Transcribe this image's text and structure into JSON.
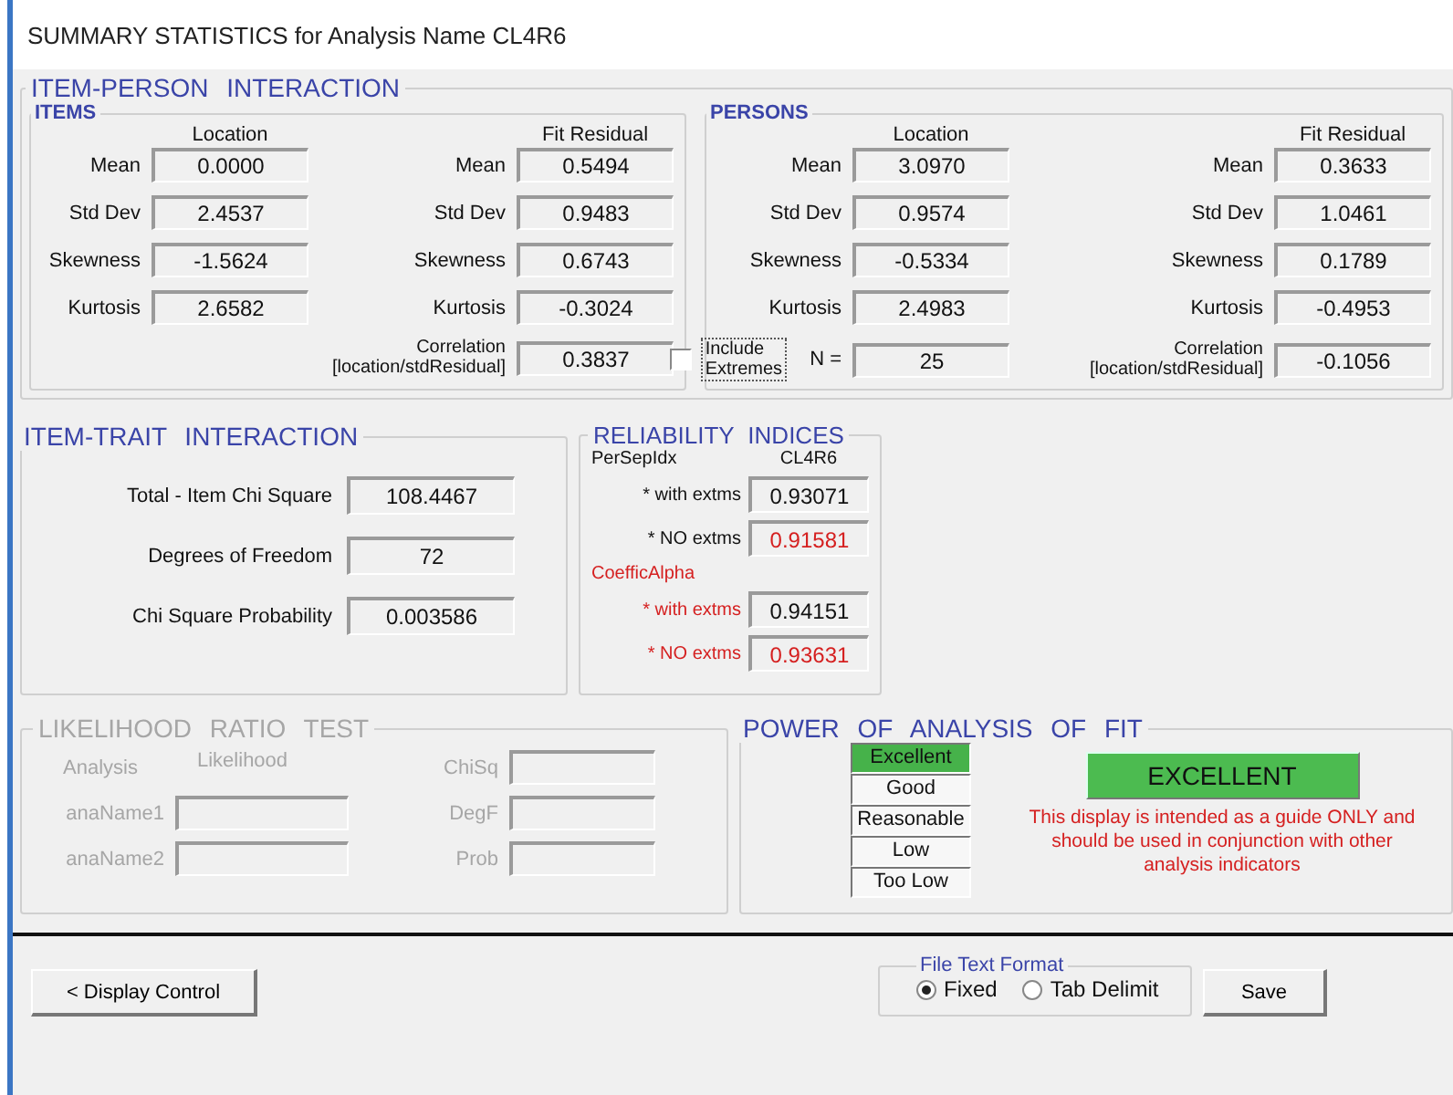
{
  "window": {
    "title": "SUMMARY STATISTICS for Analysis Name CL4R6"
  },
  "item_person": {
    "title": "ITEM-PERSON INTERACTION",
    "items": {
      "title": "ITEMS",
      "location_header": "Location",
      "fit_header": "Fit Residual",
      "location": [
        {
          "label": "Mean",
          "value": "0.0000"
        },
        {
          "label": "Std Dev",
          "value": "2.4537"
        },
        {
          "label": "Skewness",
          "value": "-1.5624"
        },
        {
          "label": "Kurtosis",
          "value": "2.6582"
        }
      ],
      "fit": [
        {
          "label": "Mean",
          "value": "0.5494"
        },
        {
          "label": "Std Dev",
          "value": "0.9483"
        },
        {
          "label": "Skewness",
          "value": "0.6743"
        },
        {
          "label": "Kurtosis",
          "value": "-0.3024"
        },
        {
          "label": "Correlation\n[location/stdResidual]",
          "value": "0.3837"
        }
      ]
    },
    "persons": {
      "title": "PERSONS",
      "location_header": "Location",
      "fit_header": "Fit Residual",
      "location": [
        {
          "label": "Mean",
          "value": "3.0970"
        },
        {
          "label": "Std Dev",
          "value": "0.9574"
        },
        {
          "label": "Skewness",
          "value": "-0.5334"
        },
        {
          "label": "Kurtosis",
          "value": "2.4983"
        }
      ],
      "fit": [
        {
          "label": "Mean",
          "value": "0.3633"
        },
        {
          "label": "Std Dev",
          "value": "1.0461"
        },
        {
          "label": "Skewness",
          "value": "0.1789"
        },
        {
          "label": "Kurtosis",
          "value": "-0.4953"
        },
        {
          "label": "Correlation\n[location/stdResidual]",
          "value": "-0.1056"
        }
      ],
      "include_extremes": {
        "label": "Include\nExtremes",
        "checked": false
      },
      "n": {
        "label": "N =",
        "value": "25"
      }
    }
  },
  "item_trait": {
    "title": "ITEM-TRAIT INTERACTION",
    "rows": [
      {
        "label": "Total - Item Chi Square",
        "value": "108.4467"
      },
      {
        "label": "Degrees of Freedom",
        "value": "72"
      },
      {
        "label": "Chi Square Probability",
        "value": "0.003586"
      }
    ]
  },
  "reliability": {
    "title": "RELIABILITY INDICES",
    "column": "CL4R6",
    "groups": [
      {
        "title": "PerSepIdx",
        "title_alert": false,
        "rows": [
          {
            "label": "* with extms",
            "value": "0.93071",
            "label_alert": false,
            "value_alert": false
          },
          {
            "label": "* NO extms",
            "value": "0.91581",
            "label_alert": false,
            "value_alert": true
          }
        ]
      },
      {
        "title": "CoefficAlpha",
        "title_alert": true,
        "rows": [
          {
            "label": "* with extms",
            "value": "0.94151",
            "label_alert": true,
            "value_alert": false
          },
          {
            "label": "* NO extms",
            "value": "0.93631",
            "label_alert": true,
            "value_alert": true
          }
        ]
      }
    ]
  },
  "likelihood": {
    "title": "LIKELIHOOD RATIO TEST",
    "disabled": true,
    "analysis_header": "Analysis",
    "likelihood_header": "Likelihood",
    "analyses": [
      {
        "label": "anaName1"
      },
      {
        "label": "anaName2"
      }
    ],
    "stats": [
      {
        "label": "ChiSq"
      },
      {
        "label": "DegF"
      },
      {
        "label": "Prob"
      }
    ]
  },
  "power": {
    "title": "POWER OF ANALYSIS OF FIT",
    "levels": [
      {
        "label": "Excellent",
        "selected": true
      },
      {
        "label": "Good",
        "selected": false
      },
      {
        "label": "Reasonable",
        "selected": false
      },
      {
        "label": "Low",
        "selected": false
      },
      {
        "label": "Too Low",
        "selected": false
      }
    ],
    "result": "EXCELLENT",
    "note": "This display is intended as a guide ONLY and should be used in conjunction with other analysis indicators"
  },
  "footer": {
    "display_control": "< Display Control",
    "file_format": {
      "title": "File Text Format",
      "options": [
        {
          "label": "Fixed",
          "selected": true
        },
        {
          "label": "Tab Delimit",
          "selected": false
        }
      ]
    },
    "save": "Save"
  }
}
